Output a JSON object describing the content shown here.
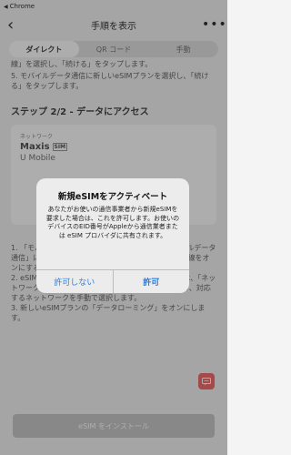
{
  "status_bar": {
    "back_app": "Chrome"
  },
  "nav": {
    "title": "手順を表示",
    "back_glyph": "‹",
    "more_glyph": "•••"
  },
  "tabs": [
    {
      "label": "ダイレクト",
      "active": true
    },
    {
      "label": "QR コード",
      "active": false
    },
    {
      "label": "手動",
      "active": false
    }
  ],
  "top_text": [
    "線」を選択し、「続ける」をタップします。",
    "5. モバイルデータ通信に新しいeSIMプランを選択し、「続ける」をタップします。"
  ],
  "step_heading": "ステップ 2/2 - データにアクセス",
  "card": {
    "network_label": "ネットワーク",
    "carrier": "Maxis",
    "sim_icon": "SIM",
    "secondary": "U Mobile"
  },
  "instructions": [
    "1. 「モバイル通信」でeSIMプランを選択し、「モバイルデータ通信」にダウンロードしたeSIMを選択します。この回線をオンにする",
    "2. eSIMプランのネットワークに接続されている場合は、「ネットワーク選択」をタップし、「自動」をオフにしてから、対応するネットワークを手動で選択します。",
    "3. 新しいeSIMプランの「データローミング」をオンにします。"
  ],
  "chat_icon": "chat-icon",
  "install_button": "eSIM をインストール",
  "alert": {
    "title": "新規eSIMをアクティベート",
    "message": "あなたがお使いの通信事業者から新規eSIMを要求した場合は、これを許可します。お使いのデバイスのEID番号がAppleから通信業者または eSIM プロバイダに共有されます。",
    "cancel": "許可しない",
    "confirm": "許可"
  },
  "colors": {
    "accent": "#2a7de1",
    "chat": "#f46e6e",
    "install_disabled": "#c9c9c9"
  }
}
